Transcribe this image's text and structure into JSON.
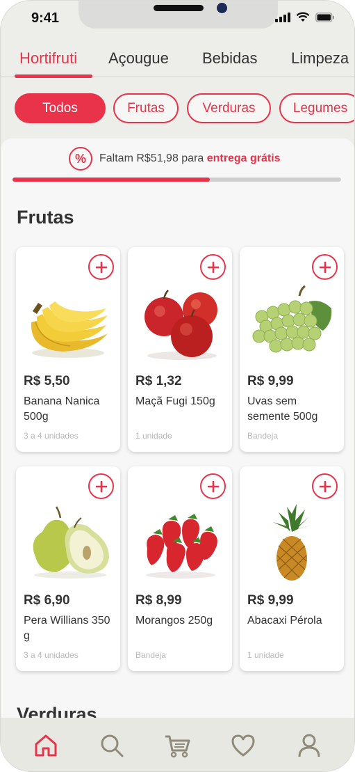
{
  "status_bar": {
    "time": "9:41"
  },
  "categories": [
    {
      "label": "Hortifruti",
      "active": true
    },
    {
      "label": "Açougue",
      "active": false
    },
    {
      "label": "Bebidas",
      "active": false
    },
    {
      "label": "Limpeza",
      "active": false
    }
  ],
  "filters": [
    {
      "label": "Todos",
      "active": true
    },
    {
      "label": "Frutas",
      "active": false
    },
    {
      "label": "Verduras",
      "active": false
    },
    {
      "label": "Legumes",
      "active": false
    }
  ],
  "promo": {
    "icon": "percent-icon",
    "text_prefix": "Faltam R$51,98 para ",
    "text_highlight": "entrega grátis",
    "progress": 0.6
  },
  "sections": {
    "frutas": "Frutas",
    "verduras": "Verduras"
  },
  "products": [
    {
      "price": "R$ 5,50",
      "name": "Banana Nanica 500g",
      "note": "3 a 4 unidades",
      "image": "banana"
    },
    {
      "price": "R$ 1,32",
      "name": "Maçã Fugi 150g",
      "note": "1 unidade",
      "image": "apple"
    },
    {
      "price": "R$ 9,99",
      "name": "Uvas sem semente 500g",
      "note": "Bandeja",
      "image": "grapes"
    },
    {
      "price": "R$ 6,90",
      "name": "Pera Willians 350 g",
      "note": "3 a 4 unidades",
      "image": "pear"
    },
    {
      "price": "R$ 8,99",
      "name": "Morangos 250g",
      "note": "Bandeja",
      "image": "strawberry"
    },
    {
      "price": "R$ 9,99",
      "name": "Abacaxi Pérola",
      "note": "1 unidade",
      "image": "pineapple"
    }
  ],
  "bottom_nav": [
    {
      "icon": "home-icon",
      "active": true
    },
    {
      "icon": "search-icon",
      "active": false
    },
    {
      "icon": "cart-icon",
      "active": false
    },
    {
      "icon": "heart-icon",
      "active": false
    },
    {
      "icon": "user-icon",
      "active": false
    }
  ],
  "colors": {
    "accent": "#e8334a",
    "background": "#ededea",
    "icon_inactive": "#8f8a7a"
  }
}
